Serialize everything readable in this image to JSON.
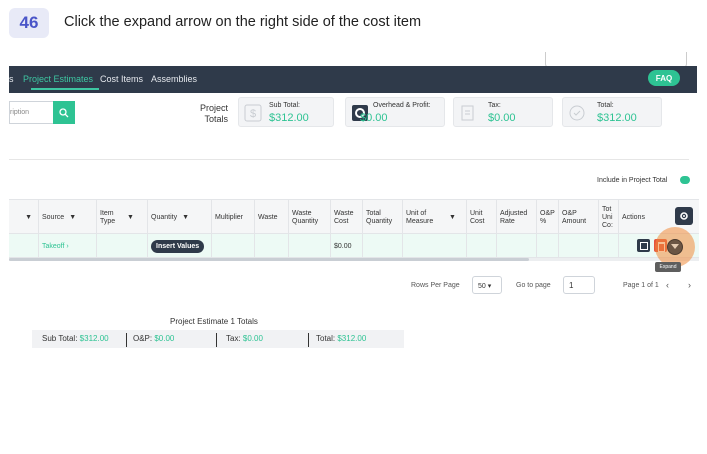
{
  "step": {
    "number": "46",
    "instruction": "Click the expand arrow on the right side of the cost item"
  },
  "nav": {
    "items": [
      "s",
      "Project Estimates",
      "Cost Items",
      "Assemblies"
    ],
    "faq": "FAQ"
  },
  "search": {
    "placeholder": "ription"
  },
  "project_totals": {
    "label": "Project Totals",
    "cards": [
      {
        "label": "Sub Total:",
        "value": "$312.00",
        "icon": "dollar-icon"
      },
      {
        "label": "Overhead & Profit:",
        "value": "$0.00",
        "icon": "gear-icon"
      },
      {
        "label": "Tax:",
        "value": "$0.00",
        "icon": "receipt-icon"
      },
      {
        "label": "Total:",
        "value": "$312.00",
        "icon": "check-circle-icon"
      }
    ]
  },
  "include_label": "Include in Project Total",
  "table": {
    "headers": [
      "Source",
      "Item Type",
      "Quantity",
      "Multiplier",
      "Waste",
      "Waste Quantity",
      "Waste Cost",
      "Total Quantity",
      "Unit of Measure",
      "Unit Cost",
      "Adjusted Rate",
      "O&P %",
      "O&P Amount",
      "Tot Uni Co:",
      "Actions"
    ],
    "row": {
      "source": "Takeoff ›",
      "quantity_button": "Insert Values",
      "waste_cost": "$0.00"
    }
  },
  "tooltip": "Expand",
  "pagination": {
    "rows_per_page_label": "Rows Per Page",
    "rows_per_page": "50",
    "go_to_page_label": "Go to page",
    "page": "1",
    "page_of": "Page 1 of 1"
  },
  "estimate_totals": {
    "title": "Project Estimate 1 Totals",
    "sub_total_label": "Sub Total:",
    "sub_total": "$312.00",
    "op_label": "O&P:",
    "op": "$0.00",
    "tax_label": "Tax:",
    "tax": "$0.00",
    "total_label": "Total:",
    "total": "$312.00"
  },
  "colors": {
    "accent": "#2ec393",
    "nav_bg": "#2f3a4a",
    "badge": "#4a55c8",
    "highlight": "#f08c3c"
  }
}
